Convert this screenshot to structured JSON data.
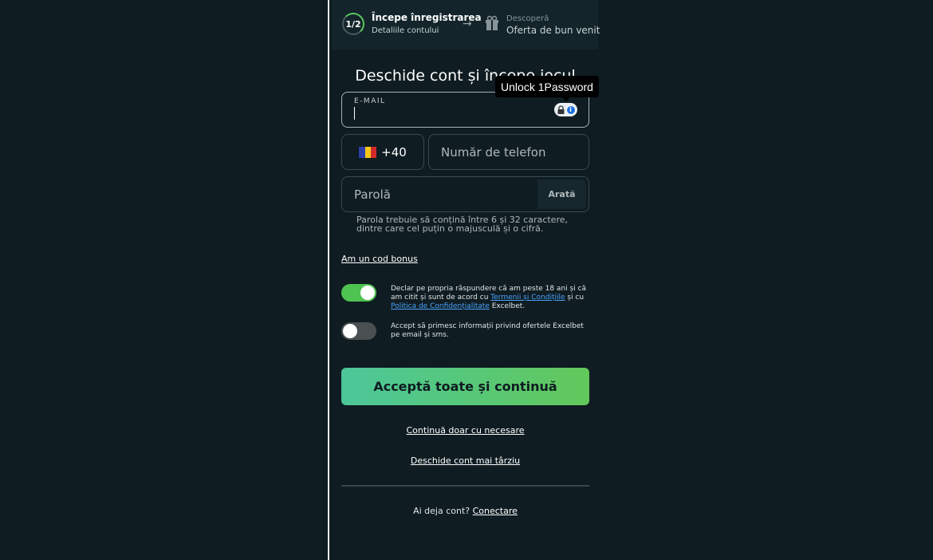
{
  "steps": {
    "step1": {
      "counter": "1/2",
      "title": "Începe înregistrarea",
      "subtitle": "Detaliile contului"
    },
    "arrow_icon": "arrow-right-icon",
    "step2": {
      "icon": "gift-icon",
      "kicker": "Descoperă",
      "title": "Oferta de bun venit"
    }
  },
  "heading": "Deschide cont și începe jocul",
  "tooltip": "Unlock 1Password",
  "email": {
    "label": "E-MAIL",
    "value": ""
  },
  "phone": {
    "country_code": "+40",
    "flag": "RO",
    "placeholder": "Număr de telefon"
  },
  "password": {
    "placeholder": "Parolă",
    "show_label": "Arată",
    "hint": "Parola trebuie să conțină între 6 și 32 caractere, dintre care cel puțin o majusculă și o cifră."
  },
  "bonus_link": "Am un cod bonus",
  "consent_age": {
    "enabled": true,
    "text_before": "Declar pe propria răspundere că am peste 18 ani și că am citit și sunt de acord cu ",
    "terms_link": "Termenii și Condițiile",
    "text_mid": " și cu ",
    "privacy_link": "Politica de Confidențialitate",
    "text_after": " Excelbet."
  },
  "consent_marketing": {
    "enabled": false,
    "text": "Accept să primesc informații privind ofertele Excelbet pe email și sms."
  },
  "primary_button": "Acceptă toate și continuă",
  "necessary_link": "Continuă doar cu necesare",
  "later_link": "Deschide cont mai târziu",
  "login": {
    "prompt": "Ai deja cont? ",
    "link": "Conectare"
  },
  "colors": {
    "background": "#0f1c21",
    "accent_green": "#4fc352",
    "link_blue": "#4aa3ff"
  }
}
